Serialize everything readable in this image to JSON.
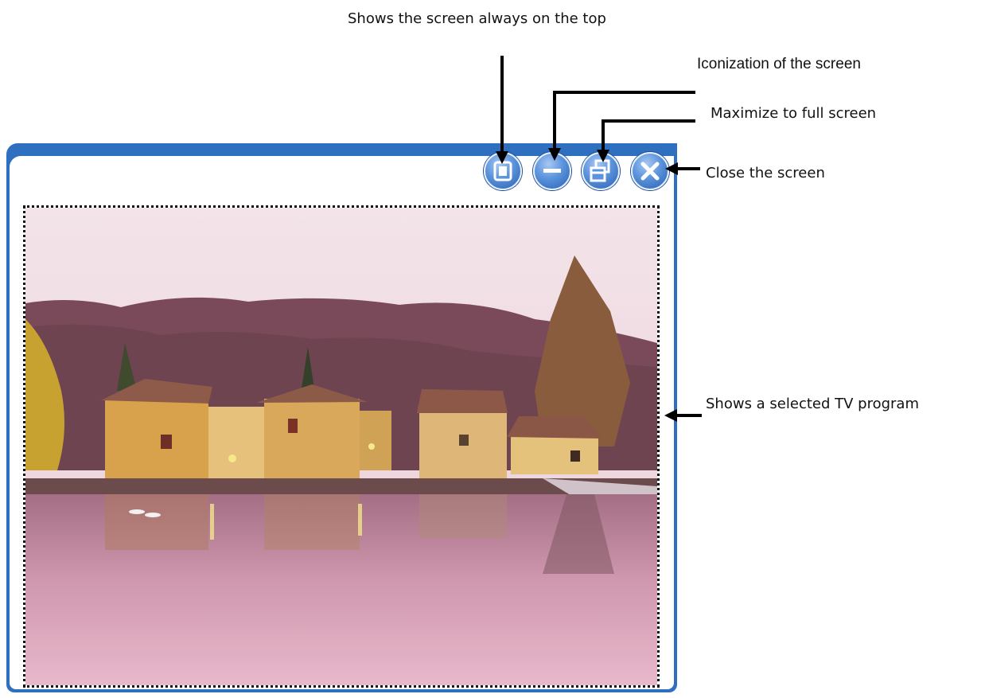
{
  "callouts": {
    "always_on_top": "Shows the screen always on the top",
    "iconization": "Iconization of the screen",
    "maximize": "Maximize to full screen",
    "close": "Close the screen",
    "tv_program": "Shows a selected TV program"
  },
  "window": {
    "buttons": [
      {
        "name": "always-on-top-button",
        "icon": "pin-window-icon"
      },
      {
        "name": "minimize-button",
        "icon": "minus-icon"
      },
      {
        "name": "maximize-button",
        "icon": "restore-window-icon"
      },
      {
        "name": "close-button",
        "icon": "close-icon"
      }
    ],
    "screen_content": "tv-program-picture"
  },
  "colors": {
    "frame": "#2f6fc0",
    "button_light": "#a8c8f2",
    "button_dark": "#2a5fb0"
  }
}
